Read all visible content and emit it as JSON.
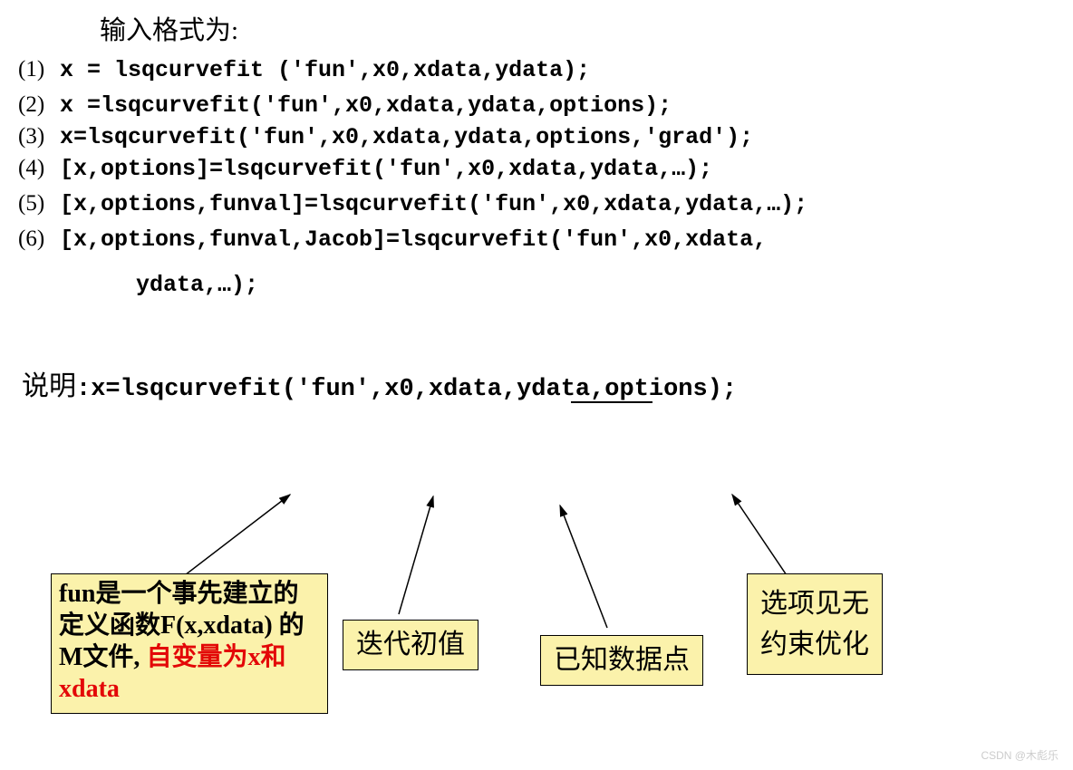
{
  "title": "输入格式为:",
  "rows": [
    {
      "n": "(1)",
      "code": "x = lsqcurvefit ('fun',x0,xdata,ydata);"
    },
    {
      "n": "(2)",
      "code": "x =lsqcurvefit('fun',x0,xdata,ydata,options);"
    },
    {
      "n": "(3)",
      "code": "x=lsqcurvefit('fun',x0,xdata,ydata,options,'grad');"
    },
    {
      "n": "(4)",
      "code": "[x,options]=lsqcurvefit('fun',x0,xdata,ydata,…);"
    },
    {
      "n": "(5)",
      "code": "[x,options,funval]=lsqcurvefit('fun',x0,xdata,ydata,…);"
    },
    {
      "n": "(6)",
      "code": "[x,options,funval,Jacob]=lsqcurvefit('fun',x0,xdata,"
    }
  ],
  "cont": "ydata,…);",
  "explain": {
    "label": "说明",
    "sep": ":",
    "code": "x=lsqcurvefit('fun',x0,xdata,ydata,options);"
  },
  "box1": {
    "l1": "fun是一个事先建立的",
    "l2": "定义函数F(x,xdata) 的",
    "l3a": "M文件, ",
    "l3b": "自变量为x和",
    "l4": "xdata"
  },
  "box2": "迭代初值",
  "box3": "已知数据点",
  "box4a": "选项见无",
  "box4b": "约束优化",
  "watermark": "CSDN @木彪乐"
}
